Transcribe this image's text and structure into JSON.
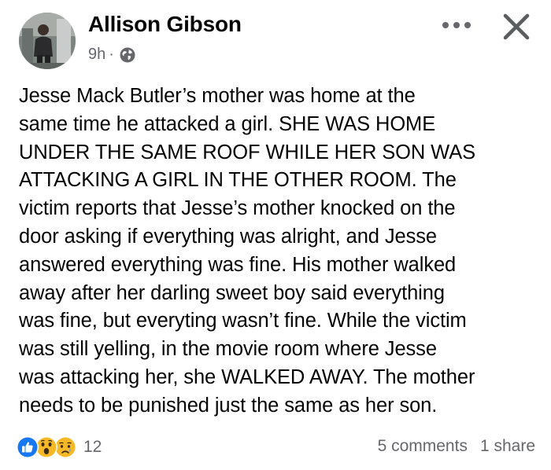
{
  "post": {
    "author": "Allison Gibson",
    "time": "9h",
    "separator": "·",
    "privacy_icon": "globe-icon",
    "body": "Jesse Mack Butler’s mother was home at the\nsame time he attacked a girl. SHE WAS HOME\nUNDER THE SAME ROOF WHILE HER SON WAS\nATTACKING A GIRL IN THE OTHER ROOM. The\nvictim reports that Jesse’s mother knocked on the\ndoor asking if everything was alright, and Jesse\nanswered everything was fine. His mother walked\naway after her darling sweet boy said everything\nwas fine, but everyting wasn’t fine. While the victim\nwas still yelling, in the movie room where Jesse\nwas attacking her, she WALKED AWAY. The mother\nneeds to be punished just the same as her son.",
    "reactions": {
      "icons": [
        "like-icon",
        "wow-icon",
        "sad-icon"
      ],
      "count": "12"
    },
    "comments": "5 comments",
    "shares": "1 share"
  },
  "controls": {
    "more_icon": "more-options-icon",
    "close_icon": "close-icon"
  },
  "colors": {
    "like_blue": "#1877f2",
    "reaction_yellow": "#f7b928",
    "secondary_text": "#65676b",
    "primary_text": "#050505"
  }
}
